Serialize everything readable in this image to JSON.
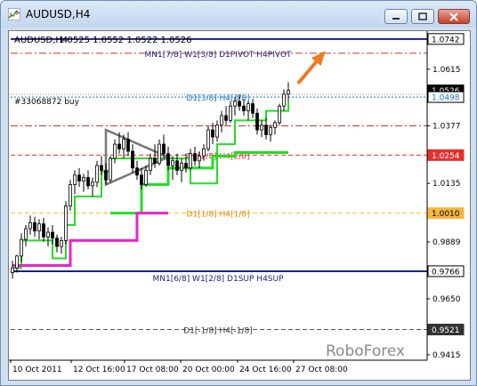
{
  "window": {
    "title": "AUDUSD,H4",
    "buttons": [
      "minimize",
      "maximize",
      "close"
    ]
  },
  "chart_header": {
    "symbol": "AUDUSD,H4",
    "ohlc": "1.0525 1.0552 1.0522 1.0526"
  },
  "brand": "RoboForex",
  "chart_data": {
    "type": "candlestick",
    "symbol": "AUDUSD",
    "timeframe": "H4",
    "ylim": [
      0.9392,
      1.0775
    ],
    "y_ticks": [
      "1.0742",
      "1.0615",
      "1.0498",
      "1.0377",
      "1.0254",
      "1.0135",
      "1.0010",
      "0.9889",
      "0.9766",
      "0.9650",
      "0.9521",
      "0.9415"
    ],
    "x_ticks": [
      "10 Oct 2011",
      "12 Oct 16:00",
      "17 Oct 08:00",
      "20 Oct 00:00",
      "24 Oct 16:00",
      "27 Oct 08:00"
    ],
    "price_labels": [
      {
        "text": "1.0742",
        "price": 1.0742,
        "bg": "#ffffff",
        "fg": "#000000"
      },
      {
        "text": "1.0526",
        "price": 1.0526,
        "bg": "#000000",
        "fg": "#ffffff"
      },
      {
        "text": "1.0498",
        "price": 1.0498,
        "bg": "#ffffff",
        "fg": "#1e73c8"
      },
      {
        "text": "1.0254",
        "price": 1.0254,
        "bg": "#e53030",
        "fg": "#ffffff"
      },
      {
        "text": "1.0010",
        "price": 1.001,
        "bg": "#f5b642",
        "fg": "#000000"
      },
      {
        "text": "0.9766",
        "price": 0.9766,
        "bg": "#ffffff",
        "fg": "#000000"
      },
      {
        "text": "0.9521",
        "price": 0.9521,
        "bg": "#333333",
        "fg": "#ffffff"
      }
    ],
    "levels": [
      {
        "price": 1.0742,
        "color": "#1a237e",
        "style": "solid",
        "width": 2,
        "label": ""
      },
      {
        "price": 1.0682,
        "color": "#c0392b",
        "style": "dashdot",
        "width": 1,
        "label": "MN1[7/8] W1[3/8] D1PIVOT H4PIVOT",
        "label_color": "#1a237e"
      },
      {
        "price": 1.0498,
        "color": "#1e73c8",
        "style": "dotted",
        "width": 1,
        "label": "D1[3/8] H4[3/8]",
        "label_color": "#1e73c8"
      },
      {
        "price": 1.0377,
        "color": "#c0392b",
        "style": "dashdot",
        "width": 1,
        "label": ""
      },
      {
        "price": 1.0254,
        "color": "#e53030",
        "style": "dashed",
        "width": 1,
        "label": "D1[2/8] H4[2/8]",
        "label_color": "#e53030"
      },
      {
        "price": 1.001,
        "color": "#f5b642",
        "style": "dashed",
        "width": 1,
        "label": "D1[1/8] H4[1/8]",
        "label_color": "#e08a00"
      },
      {
        "price": 0.9766,
        "color": "#1a237e",
        "style": "solid",
        "width": 2,
        "label": "MN1[6/8] W1[2/8] D1SUP H4SUP",
        "label_color": "#1a237e"
      },
      {
        "price": 0.9521,
        "color": "#555555",
        "style": "dashed",
        "width": 1,
        "label": "D1[-1/8] H4[-1/8]",
        "label_color": "#333333"
      }
    ],
    "order_line": {
      "text": "#33068872 buy",
      "price": 1.0509
    },
    "candles": [
      {
        "o": 0.976,
        "h": 0.981,
        "l": 0.9735,
        "c": 0.978
      },
      {
        "o": 0.978,
        "h": 0.9835,
        "l": 0.976,
        "c": 0.983
      },
      {
        "o": 0.983,
        "h": 0.9925,
        "l": 0.9805,
        "c": 0.99
      },
      {
        "o": 0.99,
        "h": 0.996,
        "l": 0.987,
        "c": 0.9945
      },
      {
        "o": 0.9945,
        "h": 1.0,
        "l": 0.992,
        "c": 0.997
      },
      {
        "o": 0.997,
        "h": 0.9995,
        "l": 0.991,
        "c": 0.9935
      },
      {
        "o": 0.9935,
        "h": 0.9985,
        "l": 0.99,
        "c": 0.9965
      },
      {
        "o": 0.9965,
        "h": 0.999,
        "l": 0.989,
        "c": 0.991
      },
      {
        "o": 0.991,
        "h": 0.995,
        "l": 0.987,
        "c": 0.993
      },
      {
        "o": 0.993,
        "h": 0.996,
        "l": 0.988,
        "c": 0.9905
      },
      {
        "o": 0.9905,
        "h": 0.992,
        "l": 0.9845,
        "c": 0.987
      },
      {
        "o": 0.987,
        "h": 0.991,
        "l": 0.984,
        "c": 0.9895
      },
      {
        "o": 0.9895,
        "h": 1.006,
        "l": 0.988,
        "c": 1.004
      },
      {
        "o": 1.004,
        "h": 1.015,
        "l": 1.002,
        "c": 1.013
      },
      {
        "o": 1.013,
        "h": 1.019,
        "l": 1.009,
        "c": 1.017
      },
      {
        "o": 1.017,
        "h": 1.02,
        "l": 1.012,
        "c": 1.0145
      },
      {
        "o": 1.0145,
        "h": 1.0175,
        "l": 1.01,
        "c": 1.016
      },
      {
        "o": 1.016,
        "h": 1.019,
        "l": 1.011,
        "c": 1.0125
      },
      {
        "o": 1.0125,
        "h": 1.016,
        "l": 1.008,
        "c": 1.014
      },
      {
        "o": 1.014,
        "h": 1.023,
        "l": 1.012,
        "c": 1.021
      },
      {
        "o": 1.021,
        "h": 1.025,
        "l": 1.017,
        "c": 1.019
      },
      {
        "o": 1.019,
        "h": 1.022,
        "l": 1.013,
        "c": 1.015
      },
      {
        "o": 1.015,
        "h": 1.025,
        "l": 1.014,
        "c": 1.024
      },
      {
        "o": 1.024,
        "h": 1.032,
        "l": 1.022,
        "c": 1.03
      },
      {
        "o": 1.03,
        "h": 1.035,
        "l": 1.026,
        "c": 1.028
      },
      {
        "o": 1.028,
        "h": 1.034,
        "l": 1.024,
        "c": 1.032
      },
      {
        "o": 1.032,
        "h": 1.035,
        "l": 1.025,
        "c": 1.027
      },
      {
        "o": 1.027,
        "h": 1.03,
        "l": 1.018,
        "c": 1.02
      },
      {
        "o": 1.02,
        "h": 1.023,
        "l": 1.015,
        "c": 1.017
      },
      {
        "o": 1.017,
        "h": 1.02,
        "l": 1.011,
        "c": 1.013
      },
      {
        "o": 1.013,
        "h": 1.021,
        "l": 1.012,
        "c": 1.019
      },
      {
        "o": 1.019,
        "h": 1.026,
        "l": 1.017,
        "c": 1.024
      },
      {
        "o": 1.024,
        "h": 1.03,
        "l": 1.02,
        "c": 1.022
      },
      {
        "o": 1.022,
        "h": 1.032,
        "l": 1.021,
        "c": 1.03
      },
      {
        "o": 1.03,
        "h": 1.034,
        "l": 1.024,
        "c": 1.026
      },
      {
        "o": 1.026,
        "h": 1.029,
        "l": 1.019,
        "c": 1.021
      },
      {
        "o": 1.021,
        "h": 1.025,
        "l": 1.015,
        "c": 1.023
      },
      {
        "o": 1.023,
        "h": 1.026,
        "l": 1.017,
        "c": 1.019
      },
      {
        "o": 1.019,
        "h": 1.024,
        "l": 1.014,
        "c": 1.022
      },
      {
        "o": 1.022,
        "h": 1.026,
        "l": 1.018,
        "c": 1.02
      },
      {
        "o": 1.02,
        "h": 1.028,
        "l": 1.019,
        "c": 1.026
      },
      {
        "o": 1.026,
        "h": 1.029,
        "l": 1.021,
        "c": 1.023
      },
      {
        "o": 1.023,
        "h": 1.027,
        "l": 1.02,
        "c": 1.025
      },
      {
        "o": 1.025,
        "h": 1.03,
        "l": 1.023,
        "c": 1.028
      },
      {
        "o": 1.028,
        "h": 1.038,
        "l": 1.027,
        "c": 1.036
      },
      {
        "o": 1.036,
        "h": 1.039,
        "l": 1.03,
        "c": 1.033
      },
      {
        "o": 1.033,
        "h": 1.04,
        "l": 1.031,
        "c": 1.038
      },
      {
        "o": 1.038,
        "h": 1.044,
        "l": 1.035,
        "c": 1.042
      },
      {
        "o": 1.042,
        "h": 1.046,
        "l": 1.038,
        "c": 1.04
      },
      {
        "o": 1.04,
        "h": 1.048,
        "l": 1.039,
        "c": 1.046
      },
      {
        "o": 1.046,
        "h": 1.05,
        "l": 1.042,
        "c": 1.048
      },
      {
        "o": 1.048,
        "h": 1.051,
        "l": 1.044,
        "c": 1.046
      },
      {
        "o": 1.046,
        "h": 1.049,
        "l": 1.042,
        "c": 1.044
      },
      {
        "o": 1.044,
        "h": 1.048,
        "l": 1.04,
        "c": 1.047
      },
      {
        "o": 1.047,
        "h": 1.049,
        "l": 1.041,
        "c": 1.043
      },
      {
        "o": 1.043,
        "h": 1.045,
        "l": 1.034,
        "c": 1.036
      },
      {
        "o": 1.036,
        "h": 1.04,
        "l": 1.033,
        "c": 1.038
      },
      {
        "o": 1.038,
        "h": 1.041,
        "l": 1.032,
        "c": 1.034
      },
      {
        "o": 1.034,
        "h": 1.038,
        "l": 1.031,
        "c": 1.037
      },
      {
        "o": 1.037,
        "h": 1.04,
        "l": 1.034,
        "c": 1.039
      },
      {
        "o": 1.039,
        "h": 1.047,
        "l": 1.038,
        "c": 1.046
      },
      {
        "o": 1.046,
        "h": 1.053,
        "l": 1.044,
        "c": 1.051
      },
      {
        "o": 1.051,
        "h": 1.056,
        "l": 1.048,
        "c": 1.0526
      }
    ],
    "green_stairs": [
      [
        0,
        0.978
      ],
      [
        2,
        0.978
      ],
      [
        2,
        0.9895
      ],
      [
        9,
        0.9895
      ],
      [
        9,
        0.982
      ],
      [
        12,
        0.982
      ],
      [
        12,
        0.996
      ],
      [
        14,
        0.996
      ],
      [
        14,
        1.008
      ],
      [
        20,
        1.008
      ],
      [
        20,
        1.0185
      ],
      [
        22,
        1.0185
      ],
      [
        22,
        1.024
      ],
      [
        40,
        1.024
      ],
      [
        40,
        1.0135
      ],
      [
        46,
        1.0135
      ],
      [
        46,
        1.03
      ],
      [
        50,
        1.03
      ],
      [
        50,
        1.04
      ],
      [
        57,
        1.04
      ],
      [
        57,
        1.044
      ],
      [
        62,
        1.044
      ],
      [
        62,
        1.048
      ]
    ],
    "green_stairs_lower": [
      [
        22,
        1.001
      ],
      [
        29,
        1.001
      ],
      [
        29,
        1.013
      ],
      [
        35,
        1.013
      ],
      [
        35,
        1.02
      ],
      [
        45,
        1.02
      ],
      [
        45,
        1.025
      ],
      [
        50,
        1.025
      ],
      [
        50,
        1.0265
      ],
      [
        62,
        1.0265
      ]
    ],
    "magenta_stairs": [
      [
        0,
        0.979
      ],
      [
        13,
        0.979
      ],
      [
        13,
        0.9895
      ],
      [
        20,
        0.9895
      ],
      [
        20,
        0.9895
      ],
      [
        28,
        0.9895
      ],
      [
        28,
        1.001
      ],
      [
        35,
        1.001
      ]
    ],
    "triangle": [
      [
        21,
        1.036
      ],
      [
        35,
        1.0245
      ],
      [
        21,
        1.013
      ]
    ],
    "arrow": {
      "from": [
        62,
        1.056
      ],
      "to": [
        67,
        1.068
      ],
      "color": "#f07a20"
    }
  }
}
